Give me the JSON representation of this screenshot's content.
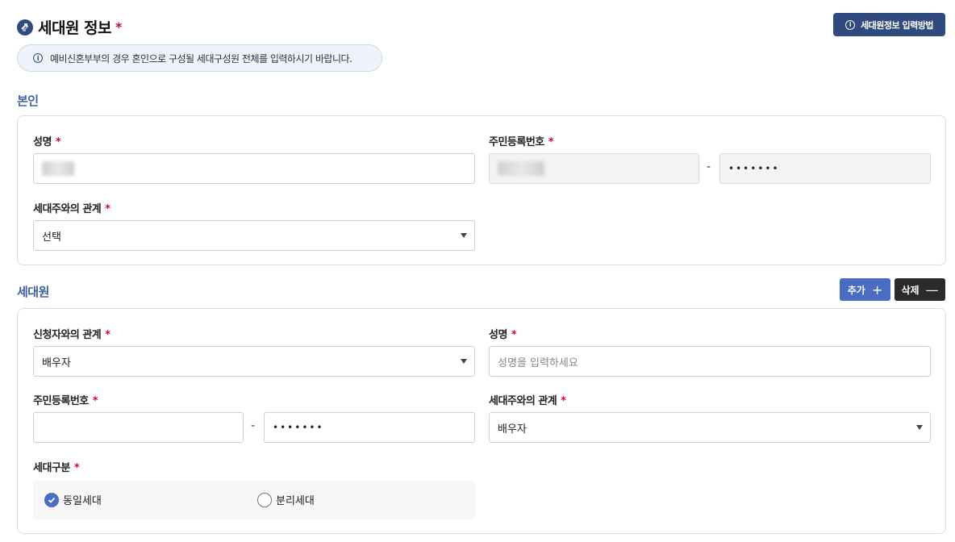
{
  "header": {
    "title": "세대원 정보",
    "required_mark": "*",
    "help_button_label": "세대원정보 입력방법",
    "notice": "예비신혼부부의 경우 혼인으로 구성될 세대구성원 전체를 입력하시기 바랍니다."
  },
  "self_section": {
    "title": "본인",
    "name_label": "성명",
    "rrn_label": "주민등록번호",
    "rrn_separator": "-",
    "rrn_back_masked": "•••••••",
    "relation_label": "세대주와의 관계",
    "relation_value": "선택"
  },
  "member_section": {
    "title": "세대원",
    "add_label": "추가",
    "add_symbol": "+",
    "delete_label": "삭제",
    "delete_symbol": "—",
    "applicant_relation_label": "신청자와의 관계",
    "applicant_relation_value": "배우자",
    "name_label": "성명",
    "name_placeholder": "성명을 입력하세요",
    "rrn_label": "주민등록번호",
    "rrn_separator": "-",
    "rrn_back_masked": "•••••••",
    "head_relation_label": "세대주와의 관계",
    "head_relation_value": "배우자",
    "household_type_label": "세대구분",
    "household_options": [
      "동일세대",
      "분리세대"
    ],
    "household_selected": "동일세대"
  },
  "colors": {
    "primary": "#2f4a7c",
    "accent": "#4a6cc3",
    "required": "#c8102e"
  }
}
